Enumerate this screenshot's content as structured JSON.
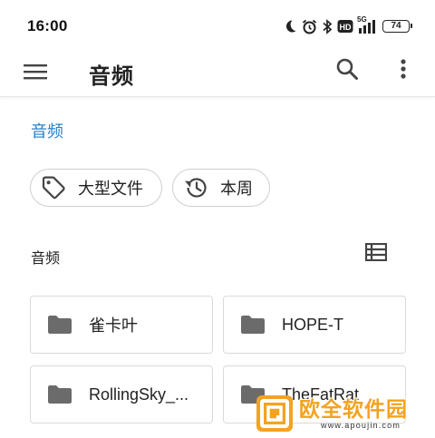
{
  "status_bar": {
    "time": "16:00",
    "network_label": "5G",
    "hd_label": "HD",
    "battery_level": "74",
    "icons": [
      "moon-icon",
      "alarm-icon",
      "bluetooth-icon",
      "hd-icon",
      "signal-icon",
      "battery-icon"
    ]
  },
  "app_bar": {
    "title": "音频",
    "icons": [
      "menu-icon",
      "search-icon",
      "more-vert-icon"
    ]
  },
  "breadcrumb": "音频",
  "chips": [
    {
      "label": "大型文件",
      "icon": "tag-icon"
    },
    {
      "label": "本周",
      "icon": "history-icon"
    }
  ],
  "section": {
    "title": "音频",
    "view_icon": "list-view-icon"
  },
  "folders": [
    {
      "name": "雀卡叶",
      "icon": "folder-icon"
    },
    {
      "name": "HOPE-T",
      "icon": "folder-icon"
    },
    {
      "name": "RollingSky_...",
      "icon": "folder-icon"
    },
    {
      "name": "TheFatRat",
      "icon": "folder-icon"
    }
  ],
  "watermark": {
    "text": "欧全软件园",
    "url": "www.apoujin.com"
  },
  "colors": {
    "accent_blue": "#2a7fc4",
    "icon_gray": "#6b6b6b",
    "watermark_orange": "#f3a321"
  }
}
